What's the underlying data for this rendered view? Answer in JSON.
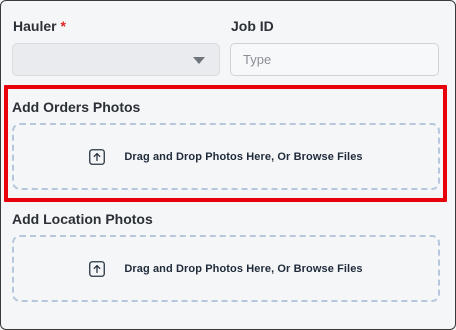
{
  "form": {
    "hauler": {
      "label": "Hauler",
      "required_marker": "*",
      "selected_value": ""
    },
    "job_id": {
      "label": "Job ID",
      "value": "",
      "placeholder": "Type"
    },
    "orders_photos": {
      "label": "Add Orders Photos",
      "dropzone_text": "Drag and Drop Photos Here, Or Browse Files",
      "icon": "upload-icon"
    },
    "location_photos": {
      "label": "Add Location Photos",
      "dropzone_text": "Drag and Drop Photos Here, Or Browse Files",
      "icon": "upload-icon"
    }
  },
  "colors": {
    "highlight_border": "#e8000b",
    "required_star": "#e02424",
    "dropzone_border": "#b6c6dc"
  }
}
